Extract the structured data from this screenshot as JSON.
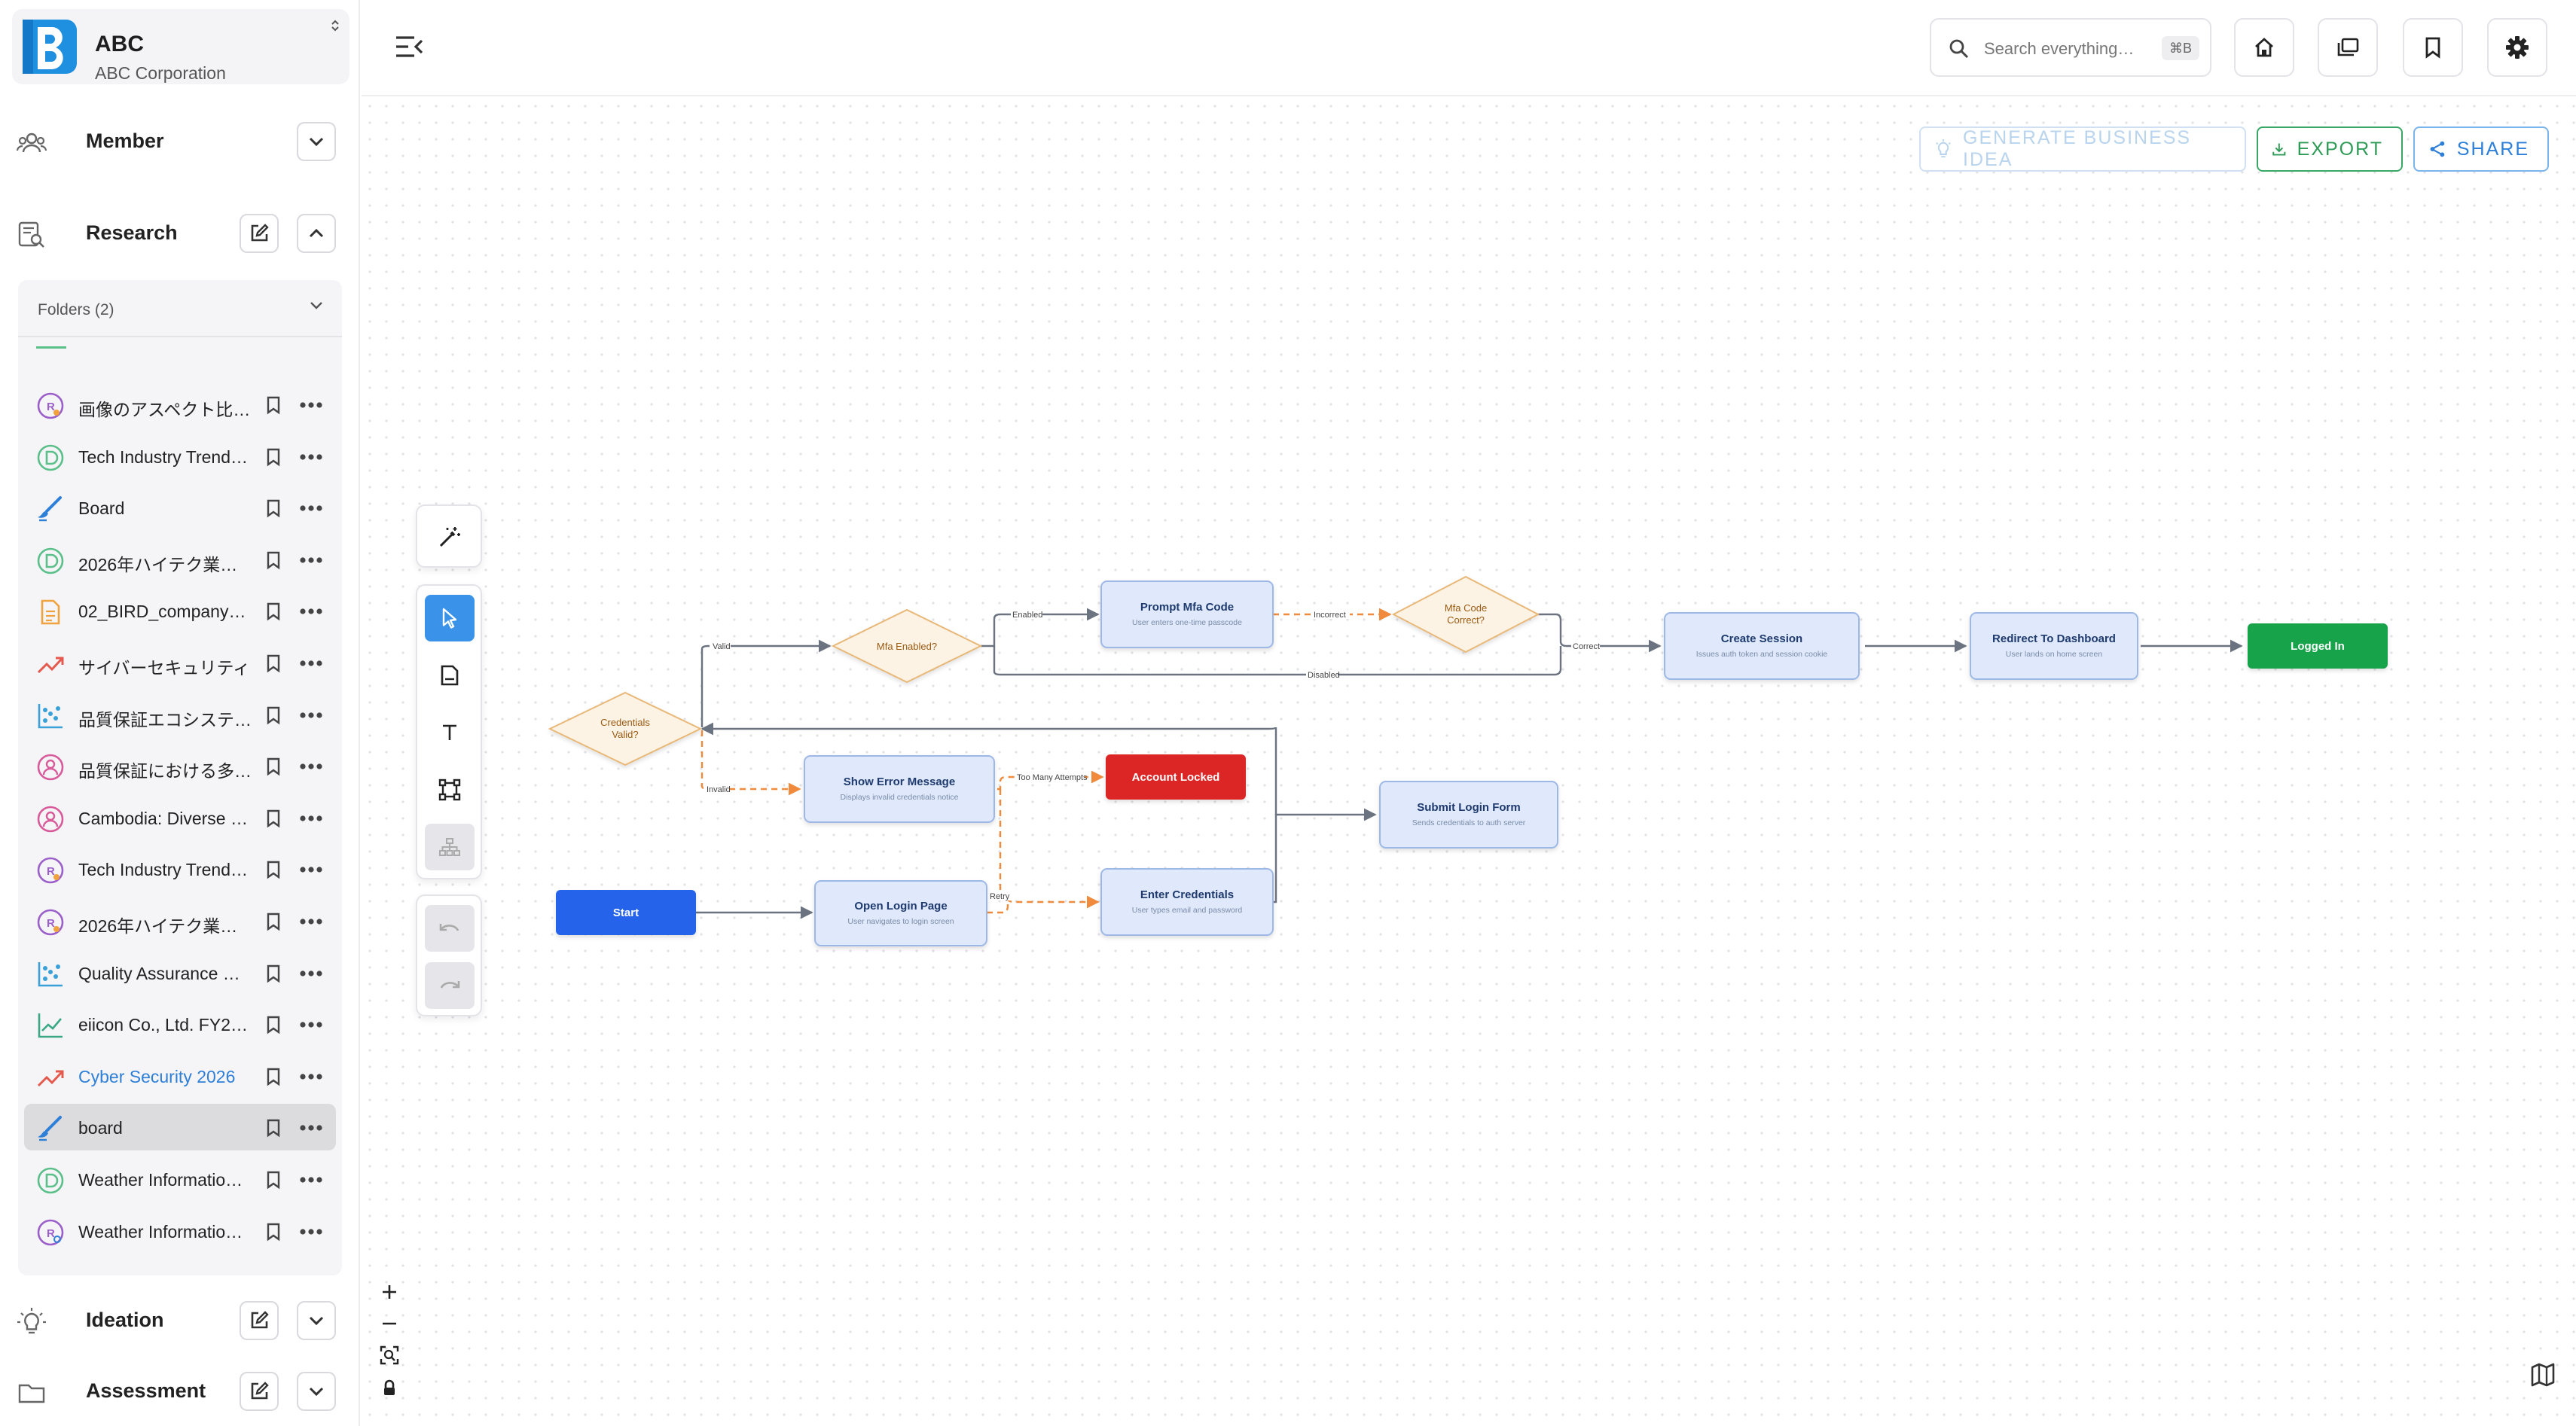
{
  "brand": {
    "name": "ABC",
    "subtitle": "ABC Corporation",
    "logo_letter": "B",
    "accent": "#1f8fe0"
  },
  "sections": {
    "member": {
      "label": "Member"
    },
    "research": {
      "label": "Research"
    },
    "ideation": {
      "label": "Ideation"
    },
    "assessment": {
      "label": "Assessment"
    }
  },
  "folders": {
    "label": "Folders (2)",
    "items": [
      {
        "label": "画像のアスペクト比…",
        "icon": "research-avatar-icon"
      },
      {
        "label": "Tech Industry Trend…",
        "icon": "data-circle-icon"
      },
      {
        "label": "Board",
        "icon": "board-brush-icon"
      },
      {
        "label": "2026年ハイテク業…",
        "icon": "data-circle-icon"
      },
      {
        "label": "02_BIRD_company_…",
        "icon": "document-icon"
      },
      {
        "label": "サイバーセキュリティ",
        "icon": "trend-up-icon"
      },
      {
        "label": "品質保証エコシステ…",
        "icon": "scatter-chart-icon"
      },
      {
        "label": "品質保証における多…",
        "icon": "persona-icon"
      },
      {
        "label": "Cambodia: Diverse …",
        "icon": "persona-icon"
      },
      {
        "label": "Tech Industry Trend…",
        "icon": "research-avatar-icon"
      },
      {
        "label": "2026年ハイテク業…",
        "icon": "research-avatar-icon"
      },
      {
        "label": "Quality Assurance …",
        "icon": "scatter-chart-icon"
      },
      {
        "label": "eiicon Co., Ltd. FY2…",
        "icon": "line-chart-icon"
      },
      {
        "label": "Cyber Security 2026",
        "icon": "trend-up-icon"
      },
      {
        "label": "board",
        "icon": "board-brush-icon",
        "selected": true
      },
      {
        "label": "Weather Informatio…",
        "icon": "data-circle-icon"
      },
      {
        "label": "Weather Informatio…",
        "icon": "research-search-icon"
      }
    ]
  },
  "header": {
    "search_placeholder": "Search everything…",
    "search_shortcut": "⌘B"
  },
  "actions": {
    "generate": "GENERATE BUSINESS IDEA",
    "export": "EXPORT",
    "share": "SHARE"
  },
  "flow": {
    "nodes": {
      "start": {
        "title": "Start"
      },
      "open_login": {
        "title": "Open Login Page",
        "desc": "User navigates to login screen"
      },
      "enter_credentials": {
        "title": "Enter Credentials",
        "desc": "User types email and password"
      },
      "submit_form": {
        "title": "Submit Login Form",
        "desc": "Sends credentials to auth server"
      },
      "credentials_valid": {
        "line1": "Credentials",
        "line2": "Valid?"
      },
      "mfa_enabled": {
        "title": "Mfa Enabled?"
      },
      "prompt_mfa": {
        "title": "Prompt Mfa Code",
        "desc": "User enters one-time passcode"
      },
      "mfa_correct": {
        "line1": "Mfa Code",
        "line2": "Correct?"
      },
      "create_session": {
        "title": "Create Session",
        "desc": "Issues auth token and session cookie"
      },
      "redirect": {
        "title": "Redirect To Dashboard",
        "desc": "User lands on home screen"
      },
      "logged_in": {
        "title": "Logged In"
      },
      "show_error": {
        "title": "Show Error Message",
        "desc": "Displays invalid credentials notice"
      },
      "account_locked": {
        "title": "Account Locked"
      }
    },
    "edges": {
      "valid": "Valid",
      "invalid": "Invalid",
      "enabled": "Enabled",
      "disabled": "Disabled",
      "incorrect": "Incorrect",
      "correct": "Correct",
      "too_many": "Too Many Attempts",
      "retry": "Retry"
    },
    "colors": {
      "process_fill": "#dfe9fb",
      "process_stroke": "#9db8e6",
      "decision_fill": "#fdf3e4",
      "decision_stroke": "#e8b878",
      "start_fill": "#2563eb",
      "success_fill": "#16a34a",
      "danger_fill": "#dc2626",
      "edge": "#6b7280",
      "edge_alt": "#f08a3c"
    }
  }
}
